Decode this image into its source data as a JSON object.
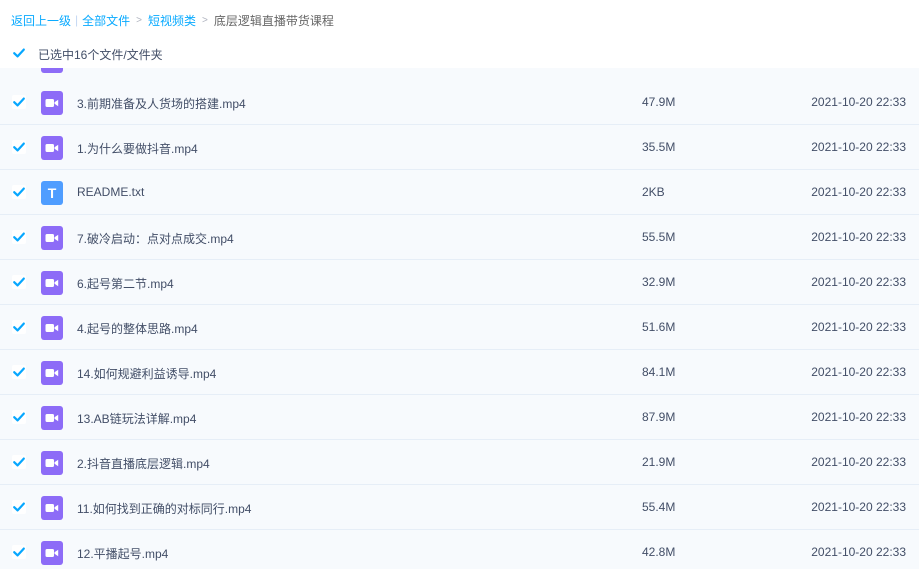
{
  "breadcrumb": {
    "back_label": "返回上一级",
    "separator": "|",
    "all_files_label": "全部文件",
    "folder_label": "短视频类",
    "arrow": ">",
    "current_label": "底层逻辑直播带货课程"
  },
  "selection": {
    "checked": true,
    "text": "已选中16个文件/文件夹"
  },
  "files": [
    {
      "name": "3.前期准备及人货场的搭建.mp4",
      "size": "47.9M",
      "date": "2021-10-20 22:33",
      "type": "video-file-icon",
      "checked": true
    },
    {
      "name": "1.为什么要做抖音.mp4",
      "size": "35.5M",
      "date": "2021-10-20 22:33",
      "type": "video-file-icon",
      "checked": true
    },
    {
      "name": "README.txt",
      "size": "2KB",
      "date": "2021-10-20 22:33",
      "type": "text-file-icon",
      "checked": true
    },
    {
      "name": "7.破冷启动：点对点成交.mp4",
      "size": "55.5M",
      "date": "2021-10-20 22:33",
      "type": "video-file-icon",
      "checked": true
    },
    {
      "name": "6.起号第二节.mp4",
      "size": "32.9M",
      "date": "2021-10-20 22:33",
      "type": "video-file-icon",
      "checked": true
    },
    {
      "name": "4.起号的整体思路.mp4",
      "size": "51.6M",
      "date": "2021-10-20 22:33",
      "type": "video-file-icon",
      "checked": true
    },
    {
      "name": "14.如何规避利益诱导.mp4",
      "size": "84.1M",
      "date": "2021-10-20 22:33",
      "type": "video-file-icon",
      "checked": true
    },
    {
      "name": "13.AB链玩法详解.mp4",
      "size": "87.9M",
      "date": "2021-10-20 22:33",
      "type": "video-file-icon",
      "checked": true
    },
    {
      "name": "2.抖音直播底层逻辑.mp4",
      "size": "21.9M",
      "date": "2021-10-20 22:33",
      "type": "video-file-icon",
      "checked": true
    },
    {
      "name": "11.如何找到正确的对标同行.mp4",
      "size": "55.4M",
      "date": "2021-10-20 22:33",
      "type": "video-file-icon",
      "checked": true
    },
    {
      "name": "12.平播起号.mp4",
      "size": "42.8M",
      "date": "2021-10-20 22:33",
      "type": "video-file-icon",
      "checked": true
    }
  ],
  "colors": {
    "link": "#09aaff",
    "checkbox": "#06a7ff",
    "video_icon": "#8d6cf7",
    "text_icon": "#4f9dff",
    "row_bg": "#f7fafd",
    "row_border": "#e6eef7",
    "text": "#424e67"
  }
}
